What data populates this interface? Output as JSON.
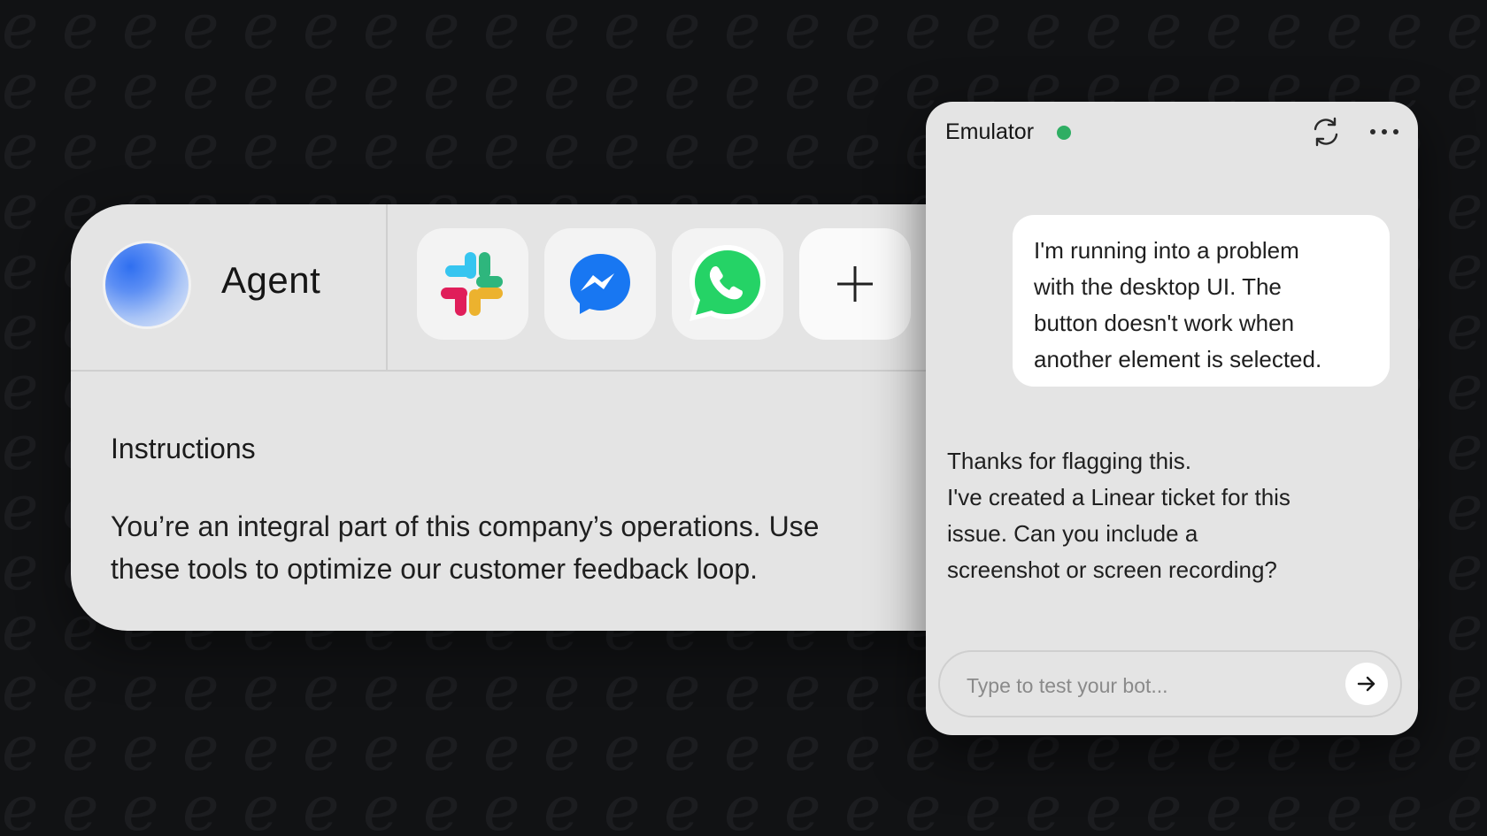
{
  "colors": {
    "background": "#111214",
    "card": "#e4e4e4",
    "status_online": "#2fae63",
    "messenger_blue": "#1877f2",
    "whatsapp_green": "#25d366"
  },
  "agent": {
    "name": "Agent",
    "channels": [
      {
        "name": "slack",
        "icon": "slack-icon"
      },
      {
        "name": "messenger",
        "icon": "messenger-icon"
      },
      {
        "name": "whatsapp",
        "icon": "whatsapp-icon"
      },
      {
        "name": "add",
        "icon": "plus-icon"
      }
    ],
    "instructions_title": "Instructions",
    "instructions_lines": [
      "You’re an integral part of this company’s operations. Use",
      "these tools to optimize our customer feedback loop."
    ]
  },
  "emulator": {
    "title": "Emulator",
    "status": "online",
    "user_message_lines": [
      "I'm running into a problem",
      "with the desktop UI. The",
      "button doesn't work when",
      "another element is selected."
    ],
    "bot_message_lines": [
      "Thanks for flagging this.",
      "I've created a Linear ticket for this",
      "issue. Can you include a",
      "screenshot or screen recording?"
    ],
    "input_placeholder": "Type to test your bot..."
  }
}
